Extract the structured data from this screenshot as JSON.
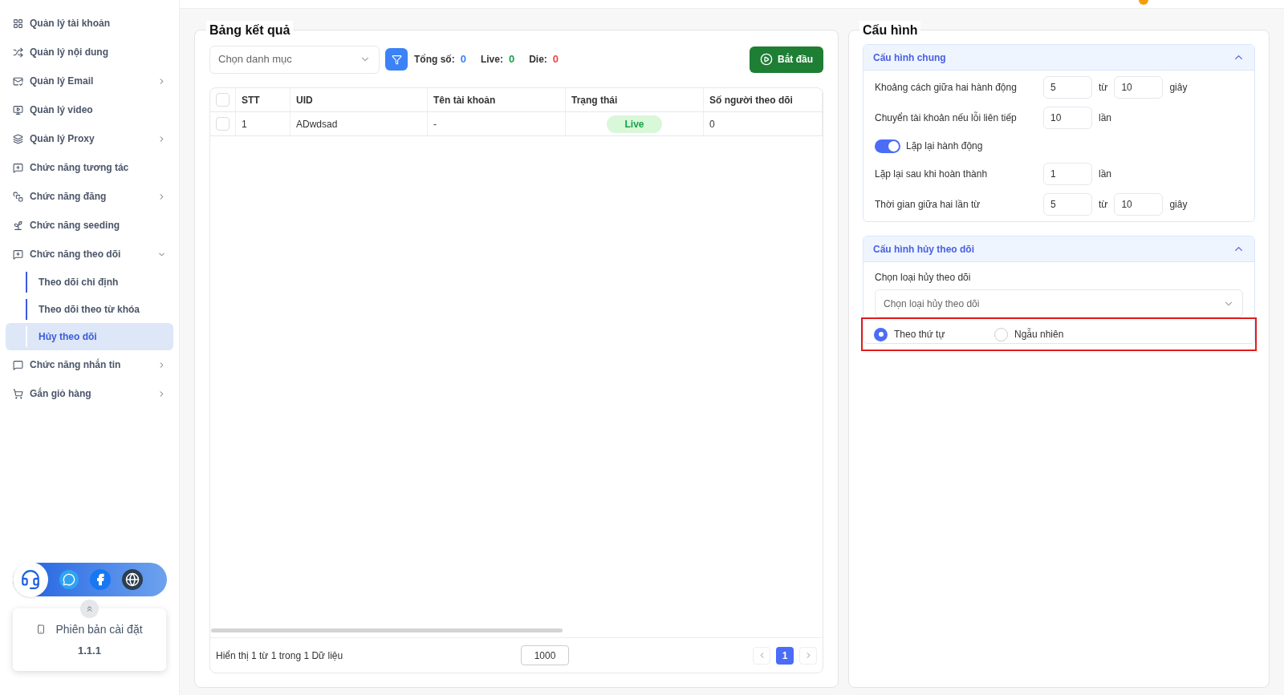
{
  "sidebar": {
    "items": [
      {
        "label": "Quản lý tài khoản",
        "expandable": false
      },
      {
        "label": "Quản lý nội dung",
        "expandable": false
      },
      {
        "label": "Quản lý Email",
        "expandable": true,
        "expanded": false
      },
      {
        "label": "Quản lý video",
        "expandable": false
      },
      {
        "label": "Quản lý Proxy",
        "expandable": true,
        "expanded": false
      },
      {
        "label": "Chức năng tương tác",
        "expandable": false
      },
      {
        "label": "Chức năng đăng",
        "expandable": true,
        "expanded": false
      },
      {
        "label": "Chức năng seeding",
        "expandable": false
      },
      {
        "label": "Chức năng theo dõi",
        "expandable": true,
        "expanded": true,
        "children": [
          {
            "label": "Theo dõi chỉ định",
            "selected": false
          },
          {
            "label": "Theo dõi theo từ khóa",
            "selected": false
          },
          {
            "label": "Hủy theo dõi",
            "selected": true
          }
        ]
      },
      {
        "label": "Chức năng nhắn tin",
        "expandable": true,
        "expanded": false
      },
      {
        "label": "Gắn giỏ hàng",
        "expandable": true,
        "expanded": false
      }
    ],
    "version": {
      "label": "Phiên bản cài đặt",
      "number": "1.1.1"
    }
  },
  "results": {
    "title": "Bảng kết quả",
    "category_placeholder": "Chọn danh mục",
    "stats": [
      {
        "label": "Tổng số:",
        "value": "0",
        "color": "#3b82f6"
      },
      {
        "label": "Live:",
        "value": "0",
        "color": "#16a34a"
      },
      {
        "label": "Die:",
        "value": "0",
        "color": "#ef4444"
      }
    ],
    "start_button": "Bắt đầu",
    "table": {
      "all_checked": false,
      "columns": [
        "STT",
        "UID",
        "Tên tài khoản",
        "Trạng thái",
        "Số người theo dõi"
      ],
      "rows": [
        {
          "checked": false,
          "cells": [
            "1",
            "ADwdsad",
            "-",
            "Live",
            "0"
          ]
        }
      ]
    },
    "footer": {
      "summary": "Hiển thị 1 từ 1 trong 1 Dữ liệu",
      "page_size": "1000",
      "pages": [
        {
          "label": "1",
          "selected": true
        }
      ]
    }
  },
  "config": {
    "title": "Cấu hình",
    "general": {
      "title": "Cấu hình chung",
      "expanded": true,
      "rows": [
        {
          "kind": "range",
          "label": "Khoảng cách giữa hai hành động",
          "from": "5",
          "sep": "từ",
          "to": "10",
          "unit": "giây"
        },
        {
          "kind": "single",
          "label": "Chuyển tài khoản nếu lỗi liên tiếp",
          "value": "10",
          "unit": "lần"
        },
        {
          "kind": "toggle",
          "label": "Lặp lại hành động",
          "on": true
        },
        {
          "kind": "single",
          "label": "Lặp lại sau khi hoàn thành",
          "value": "1",
          "unit": "lần"
        },
        {
          "kind": "range",
          "label": "Thời gian giữa hai lần từ",
          "from": "5",
          "sep": "từ",
          "to": "10",
          "unit": "giây"
        }
      ]
    },
    "unfollow": {
      "title": "Cấu hình hủy theo dõi",
      "expanded": true,
      "select_label": "Chọn loại hủy theo dõi",
      "select_placeholder": "Chọn loại hủy theo dõi",
      "options": [
        {
          "label": "Theo thứ tự",
          "selected": true
        },
        {
          "label": "Ngẫu nhiên",
          "selected": false
        }
      ]
    }
  }
}
